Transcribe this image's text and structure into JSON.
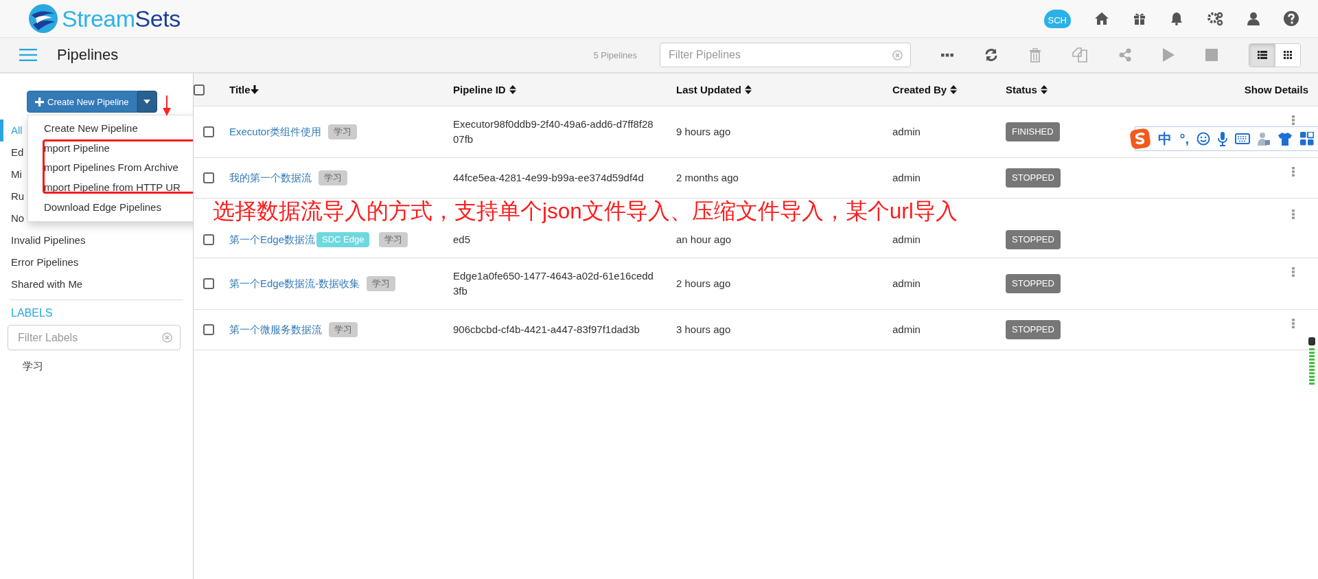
{
  "header": {
    "logo": {
      "part_1": "Stream",
      "part_2": "Sets"
    },
    "cloud_badge": "SCH"
  },
  "toolbar": {
    "title": "Pipelines",
    "count": "5 Pipelines",
    "filter_placeholder": "Filter Pipelines",
    "view_modes": [
      {
        "kind": "list",
        "selected": true
      },
      {
        "kind": "grid",
        "selected": false
      }
    ]
  },
  "sidebar": {
    "create_button": "Create New Pipeline",
    "dropdown": [
      "Create New Pipeline",
      "mport Pipeline",
      "mport Pipelines From Archive",
      "mport Pipeline from HTTP UR",
      "Download Edge Pipelines"
    ],
    "items": [
      {
        "label": "All",
        "selected": true
      },
      {
        "label": "Ed",
        "selected": false
      },
      {
        "label": "Mi",
        "selected": false
      },
      {
        "label": "Ru",
        "selected": false
      },
      {
        "label": "No",
        "selected": false
      },
      {
        "label": "Invalid Pipelines",
        "selected": false
      },
      {
        "label": "Error Pipelines",
        "selected": false
      },
      {
        "label": "Shared with Me",
        "selected": false
      }
    ],
    "labels_heading": "LABELS",
    "labels_filter_placeholder": "Filter Labels",
    "labels": [
      "学习"
    ]
  },
  "table": {
    "all_checked": false,
    "columns": [
      {
        "label": "Title",
        "sorted": true
      },
      {
        "label": "Pipeline ID",
        "sorted": false
      },
      {
        "label": "Last Updated",
        "sorted": false
      },
      {
        "label": "Created By",
        "sorted": false
      },
      {
        "label": "Status",
        "sorted": false
      },
      {
        "label": "Show Details"
      }
    ],
    "rows": [
      {
        "checked": false,
        "title": "Executor类组件使用",
        "tags": [
          {
            "label": "学习",
            "kind": "label"
          }
        ],
        "pipeline_id": "Executor98f0ddb9-2f40-49a6-add6-d7ff8f2807fb",
        "last_updated": "9 hours ago",
        "created_by": "admin",
        "status": "FINISHED"
      },
      {
        "checked": false,
        "title": "我的第一个数据流",
        "tags": [
          {
            "label": "学习",
            "kind": "label"
          }
        ],
        "pipeline_id": "44fce5ea-4281-4e99-b99a-ee374d59df4d",
        "last_updated": "2 months ago",
        "created_by": "admin",
        "status": "STOPPED"
      },
      {
        "checked": false,
        "title": "第一个Edge数据流",
        "tags": [
          {
            "label": "SDC Edge",
            "kind": "edge"
          },
          {
            "label": "学习",
            "kind": "label"
          }
        ],
        "pipeline_id": "ed5",
        "last_updated": "an hour ago",
        "created_by": "admin",
        "status": "STOPPED"
      },
      {
        "checked": false,
        "title": "第一个Edge数据流-数据收集",
        "tags": [
          {
            "label": "学习",
            "kind": "label"
          }
        ],
        "pipeline_id": "Edge1a0fe650-1477-4643-a02d-61e16cedd3fb",
        "last_updated": "2 hours ago",
        "created_by": "admin",
        "status": "STOPPED"
      },
      {
        "checked": false,
        "title": "第一个微服务数据流",
        "tags": [
          {
            "label": "学习",
            "kind": "label"
          }
        ],
        "pipeline_id": "906cbcbd-cf4b-4421-a447-83f97f1dad3b",
        "last_updated": "3 hours ago",
        "created_by": "admin",
        "status": "STOPPED"
      }
    ]
  },
  "annotation": {
    "text": "选择数据流导入的方式，支持单个json文件导入、压缩文件导入，某个url导入"
  },
  "ime_toolbar": {
    "mode": "中",
    "punctuation": "°,"
  }
}
